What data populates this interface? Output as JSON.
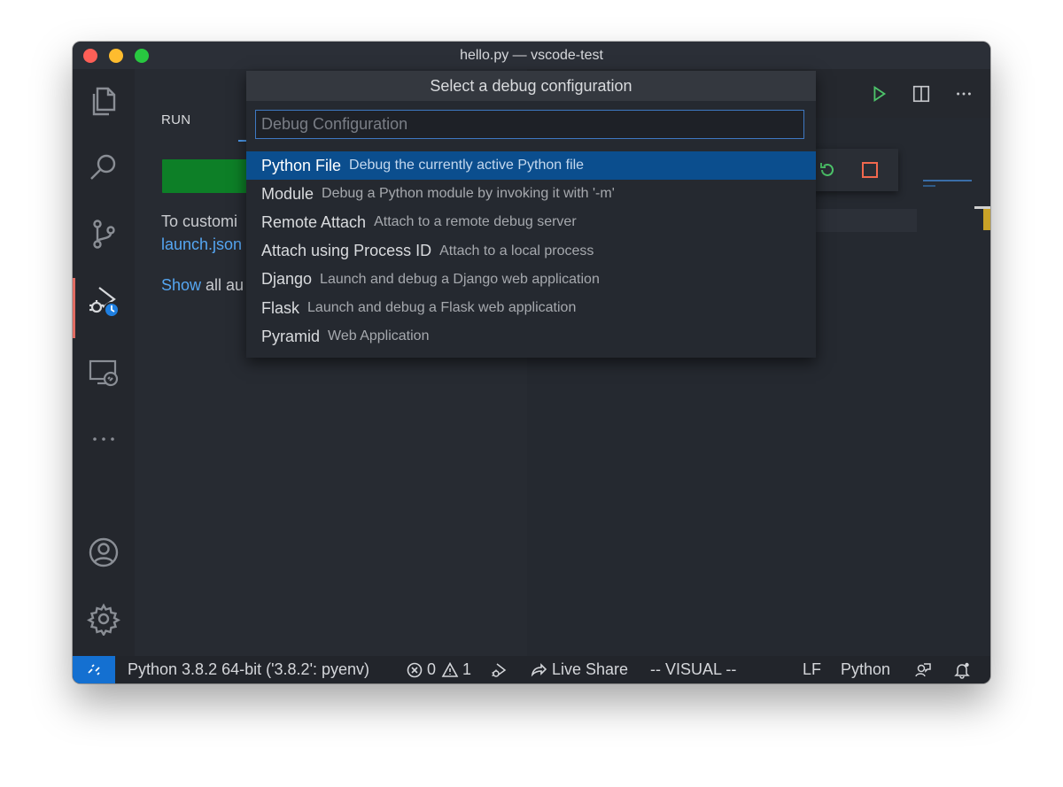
{
  "window": {
    "title": "hello.py — vscode-test"
  },
  "activity_bar": {
    "items": [
      {
        "name": "explorer",
        "icon": "files-icon"
      },
      {
        "name": "search",
        "icon": "search-icon"
      },
      {
        "name": "source-control",
        "icon": "source-control-icon"
      },
      {
        "name": "run-debug",
        "icon": "debug-icon",
        "active": true
      },
      {
        "name": "remote-explorer",
        "icon": "remote-explorer-icon"
      },
      {
        "name": "more",
        "icon": "ellipsis-icon"
      },
      {
        "name": "accounts",
        "icon": "account-icon"
      },
      {
        "name": "manage",
        "icon": "gear-icon"
      }
    ]
  },
  "sidebar": {
    "title": "RUN",
    "text_line1": "To customi",
    "link_launch": "launch.json",
    "show_link": "Show",
    "show_rest": " all au"
  },
  "quick_pick": {
    "title": "Select a debug configuration",
    "placeholder": "Debug Configuration",
    "items": [
      {
        "label": "Python File",
        "description": "Debug the currently active Python file",
        "selected": true
      },
      {
        "label": "Module",
        "description": "Debug a Python module by invoking it with '-m'"
      },
      {
        "label": "Remote Attach",
        "description": "Attach to a remote debug server"
      },
      {
        "label": "Attach using Process ID",
        "description": "Attach to a local process"
      },
      {
        "label": "Django",
        "description": "Launch and debug a Django web application"
      },
      {
        "label": "Flask",
        "description": "Launch and debug a Flask web application"
      },
      {
        "label": "Pyramid",
        "description": "Web Application"
      }
    ]
  },
  "editor": {
    "actions": [
      {
        "name": "run-python-file",
        "icon": "play-icon"
      },
      {
        "name": "split-editor",
        "icon": "split-editor-icon"
      },
      {
        "name": "more-actions",
        "icon": "ellipsis-icon"
      }
    ],
    "debug_toolbar": [
      {
        "name": "restart",
        "icon": "restart-icon"
      },
      {
        "name": "stop",
        "icon": "stop-icon"
      }
    ]
  },
  "status_bar": {
    "interpreter": "Python 3.8.2 64-bit ('3.8.2': pyenv)",
    "errors": "0",
    "warnings": "1",
    "live_share": "Live Share",
    "vim_mode": "-- VISUAL --",
    "eol": "LF",
    "language": "Python"
  },
  "colors": {
    "accent": "#0b4e8e",
    "remote": "#1470d1",
    "run_button": "#0d7f27",
    "active_indicator": "#e06c63"
  }
}
